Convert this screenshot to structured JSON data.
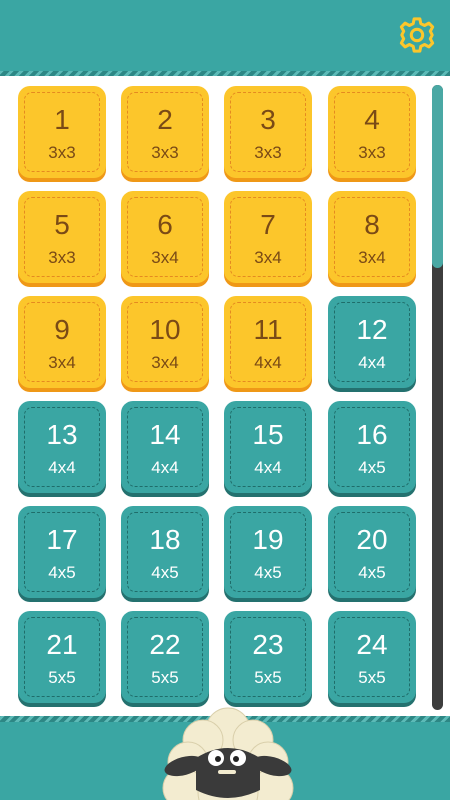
{
  "header": {
    "settings_icon": "gear-icon"
  },
  "levels": [
    {
      "num": "1",
      "size": "3x3",
      "color": "yellow"
    },
    {
      "num": "2",
      "size": "3x3",
      "color": "yellow"
    },
    {
      "num": "3",
      "size": "3x3",
      "color": "yellow"
    },
    {
      "num": "4",
      "size": "3x3",
      "color": "yellow"
    },
    {
      "num": "5",
      "size": "3x3",
      "color": "yellow"
    },
    {
      "num": "6",
      "size": "3x4",
      "color": "yellow"
    },
    {
      "num": "7",
      "size": "3x4",
      "color": "yellow"
    },
    {
      "num": "8",
      "size": "3x4",
      "color": "yellow"
    },
    {
      "num": "9",
      "size": "3x4",
      "color": "yellow"
    },
    {
      "num": "10",
      "size": "3x4",
      "color": "yellow"
    },
    {
      "num": "11",
      "size": "4x4",
      "color": "yellow"
    },
    {
      "num": "12",
      "size": "4x4",
      "color": "teal"
    },
    {
      "num": "13",
      "size": "4x4",
      "color": "teal"
    },
    {
      "num": "14",
      "size": "4x4",
      "color": "teal"
    },
    {
      "num": "15",
      "size": "4x4",
      "color": "teal"
    },
    {
      "num": "16",
      "size": "4x5",
      "color": "teal"
    },
    {
      "num": "17",
      "size": "4x5",
      "color": "teal"
    },
    {
      "num": "18",
      "size": "4x5",
      "color": "teal"
    },
    {
      "num": "19",
      "size": "4x5",
      "color": "teal"
    },
    {
      "num": "20",
      "size": "4x5",
      "color": "teal"
    },
    {
      "num": "21",
      "size": "5x5",
      "color": "teal"
    },
    {
      "num": "22",
      "size": "5x5",
      "color": "teal"
    },
    {
      "num": "23",
      "size": "5x5",
      "color": "teal"
    },
    {
      "num": "24",
      "size": "5x5",
      "color": "teal"
    }
  ],
  "colors": {
    "teal": "#3aa6a3",
    "yellow": "#fcc62b",
    "gear": "#fcc62b"
  },
  "mascot": "sheep"
}
